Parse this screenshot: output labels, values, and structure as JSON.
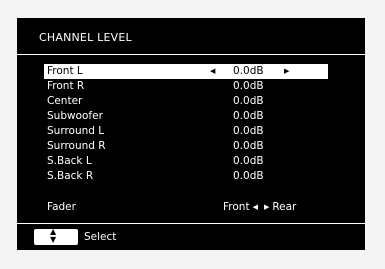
{
  "screen": {
    "title": "CHANNEL LEVEL",
    "rows": [
      {
        "label": "Front L",
        "value": "0.0dB",
        "selected": true
      },
      {
        "label": "Front R",
        "value": "0.0dB"
      },
      {
        "label": "Center",
        "value": "0.0dB"
      },
      {
        "label": "Subwoofer",
        "value": "0.0dB"
      },
      {
        "label": "Surround L",
        "value": "0.0dB"
      },
      {
        "label": "Surround R",
        "value": "0.0dB"
      },
      {
        "label": "S.Back L",
        "value": "0.0dB"
      },
      {
        "label": "S.Back R",
        "value": "0.0dB"
      }
    ],
    "fader": {
      "label": "Fader",
      "left": "Front",
      "right": "Rear"
    },
    "hint": {
      "label": "Select"
    }
  },
  "icons": {
    "left_arrow": "◀",
    "right_arrow": "▶",
    "updown": "▲▼"
  },
  "colors": {
    "background": "#000000",
    "text": "#ffffff",
    "highlight": "#ffffff",
    "highlight_text": "#000000"
  }
}
